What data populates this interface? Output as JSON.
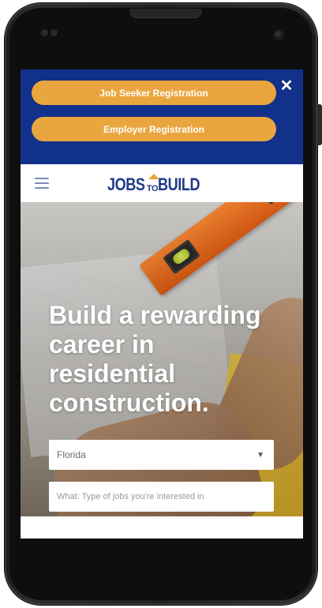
{
  "registration": {
    "job_seeker_label": "Job Seeker Registration",
    "employer_label": "Employer Registration",
    "close_glyph": "✕"
  },
  "header": {
    "logo": {
      "part1": "JOBS",
      "part2": "TO",
      "part3": "BUILD"
    },
    "menu_icon": "hamburger-icon"
  },
  "hero": {
    "headline": "Build a rewarding career in residential construction."
  },
  "search": {
    "location_value": "Florida",
    "caret_glyph": "▼",
    "what_placeholder": "What: Type of jobs you're interested in"
  },
  "colors": {
    "brand_blue": "#12318a",
    "accent_orange": "#eaa63e",
    "logo_blue": "#1e3a86"
  }
}
